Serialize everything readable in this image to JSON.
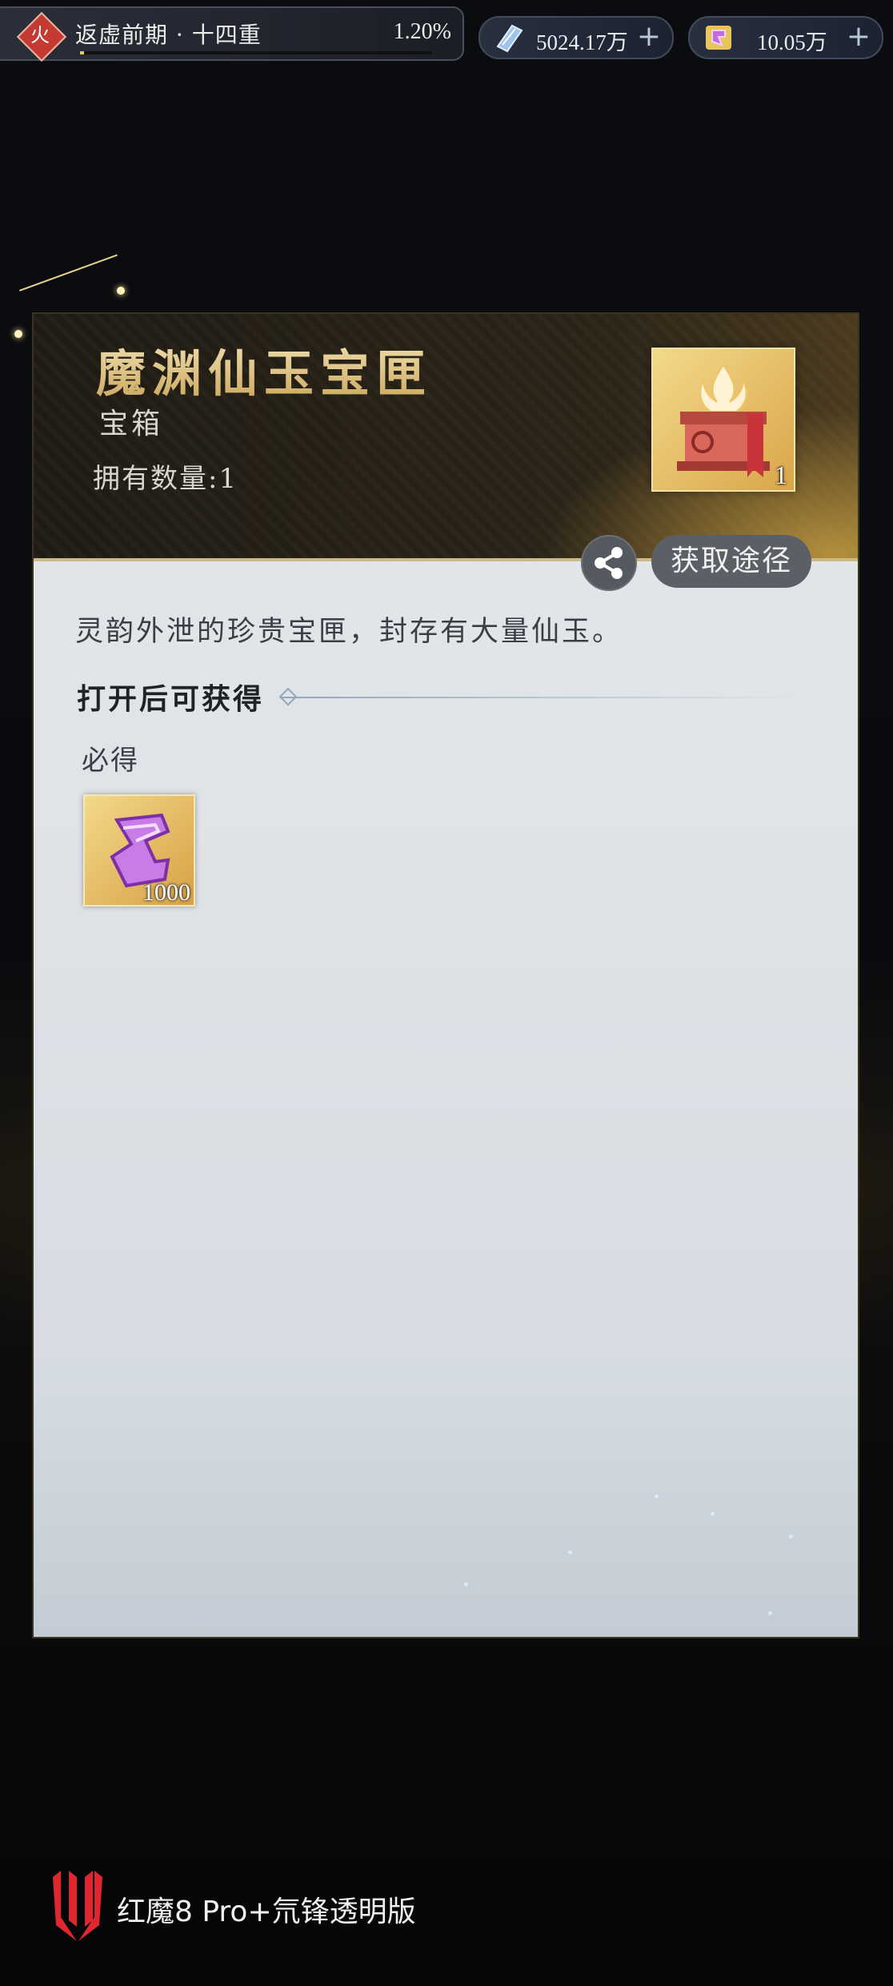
{
  "top_bar": {
    "realm": {
      "element_badge": "火",
      "name": "返虚前期 · 十四重",
      "progress": "1.20%",
      "progress_fraction": 0.012
    },
    "currency_1": {
      "icon": "spirit-crystal-icon",
      "value": "5024.17万",
      "plus": "+"
    },
    "currency_2": {
      "icon": "immortal-jade-icon",
      "value": "10.05万",
      "plus": "+"
    }
  },
  "item": {
    "name": "魔渊仙玉宝匣",
    "type": "宝箱",
    "owned": "拥有数量:1",
    "icon": "treasure-box-icon",
    "count": "1",
    "share_icon": "share-icon",
    "obtain_label": "获取途径",
    "description": "灵韵外泄的珍贵宝匣，封存有大量仙玉。",
    "section_title": "打开后可获得",
    "guaranteed_label": "必得",
    "rewards": [
      {
        "icon": "immortal-jade-icon",
        "quantity": "1000"
      }
    ]
  },
  "footer": {
    "brand_icon": "red-magic-logo-icon",
    "watermark": "红魔8 Pro+氘锋透明版"
  },
  "colors": {
    "title_gold": "#e6cf93",
    "fire_red": "#c43a32",
    "progress_yellow": "#e7cc5a"
  }
}
